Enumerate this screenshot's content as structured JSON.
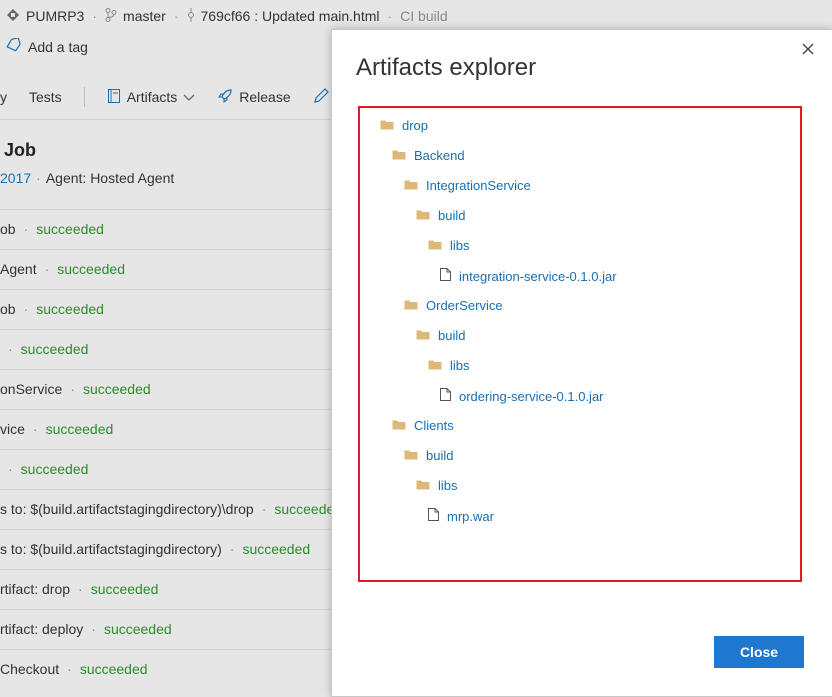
{
  "breadcrumb": {
    "project": "PUMRP3",
    "branch": "master",
    "commit": "769cf66 : Updated main.html",
    "pipeline": "CI build"
  },
  "tags": {
    "add_tag": "Add a tag"
  },
  "toolbar": {
    "summary_partial": "y",
    "tests": "Tests",
    "artifacts": "Artifacts",
    "release": "Release"
  },
  "job": {
    "title": "Job",
    "date_partial": "2017",
    "agent": "Agent: Hosted Agent"
  },
  "steps": [
    {
      "name": "ob",
      "status": "succeeded"
    },
    {
      "name": "Agent",
      "status": "succeeded"
    },
    {
      "name": "ob",
      "status": "succeeded"
    },
    {
      "name": "",
      "status": "succeeded"
    },
    {
      "name": "onService",
      "status": "succeeded"
    },
    {
      "name": "vice",
      "status": "succeeded"
    },
    {
      "name": "",
      "status": "succeeded"
    },
    {
      "name": "s to: $(build.artifactstagingdirectory)\\drop",
      "status": "succeeded"
    },
    {
      "name": "s to: $(build.artifactstagingdirectory)",
      "status": "succeeded"
    },
    {
      "name": "rtifact: drop",
      "status": "succeeded"
    },
    {
      "name": "rtifact: deploy",
      "status": "succeeded"
    },
    {
      "name": "Checkout",
      "status": "succeeded"
    }
  ],
  "modal": {
    "title": "Artifacts explorer",
    "close_label": "Close",
    "tree": [
      {
        "label": "drop",
        "type": "folder",
        "depth": 0
      },
      {
        "label": "Backend",
        "type": "folder",
        "depth": 1
      },
      {
        "label": "IntegrationService",
        "type": "folder",
        "depth": 2
      },
      {
        "label": "build",
        "type": "folder",
        "depth": 3
      },
      {
        "label": "libs",
        "type": "folder",
        "depth": 4
      },
      {
        "label": "integration-service-0.1.0.jar",
        "type": "file",
        "depth": 5
      },
      {
        "label": "OrderService",
        "type": "folder",
        "depth": 2
      },
      {
        "label": "build",
        "type": "folder",
        "depth": 3
      },
      {
        "label": "libs",
        "type": "folder",
        "depth": 4
      },
      {
        "label": "ordering-service-0.1.0.jar",
        "type": "file",
        "depth": 5
      },
      {
        "label": "Clients",
        "type": "folder",
        "depth": 1
      },
      {
        "label": "build",
        "type": "folder",
        "depth": 2
      },
      {
        "label": "libs",
        "type": "folder",
        "depth": 3
      },
      {
        "label": "mrp.war",
        "type": "file",
        "depth": 4
      }
    ]
  },
  "colors": {
    "link": "#1a6fb0",
    "success": "#2e8b2e",
    "highlight_border": "#e31b23",
    "primary_button": "#1e78d0",
    "folder": "#dcb97a"
  }
}
